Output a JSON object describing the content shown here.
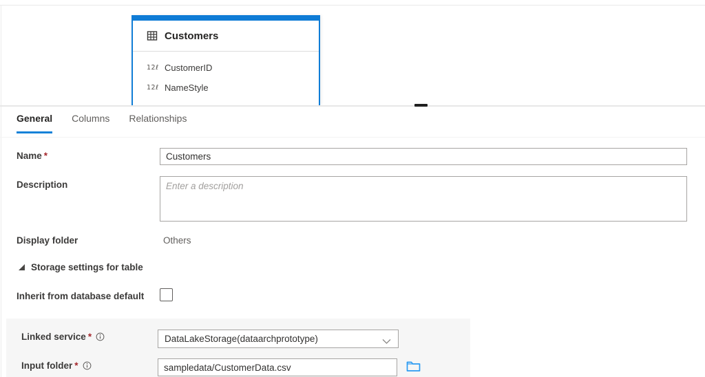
{
  "colors": {
    "accent": "#0f7cd6",
    "tab_underline": "#1181d8",
    "required_asterisk": "#a4262c",
    "folder_icon": "#2b9bf2",
    "sub_panel_bg": "#f6f6f6"
  },
  "canvas": {
    "entity_card": {
      "title": "Customers",
      "fields": [
        {
          "type_glyph": "12ℓ",
          "name": "CustomerID"
        },
        {
          "type_glyph": "12ℓ",
          "name": "NameStyle"
        }
      ]
    }
  },
  "panel": {
    "tabs": [
      {
        "label": "General",
        "active": true
      },
      {
        "label": "Columns",
        "active": false
      },
      {
        "label": "Relationships",
        "active": false
      }
    ],
    "form": {
      "name": {
        "label": "Name",
        "required": "*",
        "value": "Customers"
      },
      "description": {
        "label": "Description",
        "placeholder": "Enter a description"
      },
      "display_folder": {
        "label": "Display folder",
        "value": "Others"
      },
      "storage_section": {
        "title": "Storage settings for table"
      },
      "inherit_default": {
        "label": "Inherit from database default",
        "checked": false
      },
      "linked_service": {
        "label": "Linked service",
        "required": "*",
        "value": "DataLakeStorage(dataarchprototype)"
      },
      "input_folder": {
        "label": "Input folder",
        "required": "*",
        "value": "sampledata/CustomerData.csv"
      }
    }
  }
}
